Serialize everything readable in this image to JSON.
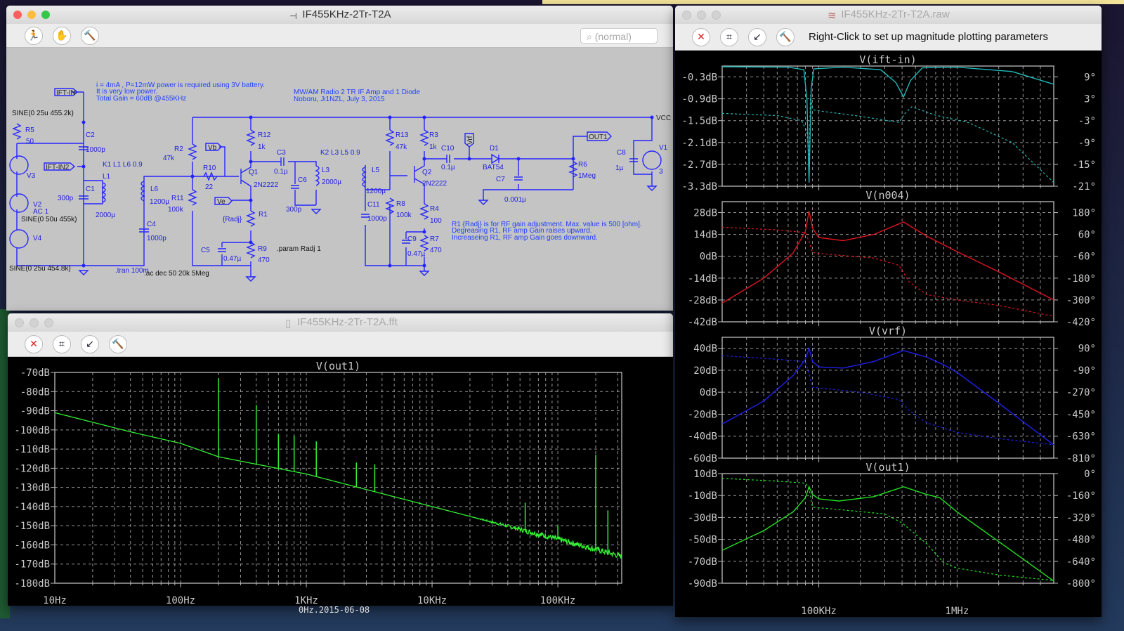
{
  "schematic_window": {
    "title": "IF455KHz-2Tr-T2A",
    "search_placeholder": "(normal)",
    "toolbar": [
      "run-icon",
      "halt-hand-icon",
      "control-panel-hammer-icon"
    ],
    "labels": {
      "note1": "i = 4mA , P=12mW power is required using 3V battery.",
      "note2": "It is very low power.",
      "note3": "Total Gain = 60dB @455KHz",
      "title1": "MW/AM Radio 2 TR IF Amp and 1 Diode",
      "title2": "Noboru, Ji1NZL, July 3, 2015",
      "ift_in": "IFT-IN",
      "ift_in2": "IFT-IN2",
      "sine_v3": "SINE(0 25u 455.2k)",
      "r5": "R5",
      "r5v": "50",
      "c2": "C2",
      "c2v": "1000p",
      "k1": "K1 L1 L6 0.9",
      "l1": "L1",
      "c1": "C1",
      "c1v": "300p",
      "l1v": "2000µ",
      "v3": "V3",
      "v2": "V2",
      "v2ac": "AC 1",
      "sine_v2": "SINE(0 50u 455k)",
      "v4": "V4",
      "sine_v4": "SINE(0 25u 454.8k)",
      "tran": ".tran 100m",
      "ac": ".ac dec 50 20k 5Meg",
      "l6": "L6",
      "l6v": "1200µ",
      "c4": "C4",
      "c4v": "1000p",
      "r2": "R2",
      "r2v": "47k",
      "r10": "R10",
      "r10v": "22",
      "r11": "R11",
      "r11v": "100k",
      "vb": "Vb",
      "ve": "Ve",
      "r12": "R12",
      "r12v": "1k",
      "q1": "Q1",
      "q1v": "2N2222",
      "c3": "C3",
      "c3v": "0.1µ",
      "c6": "C6",
      "c6v": "300p",
      "l3": "L3",
      "l3v": "2000µ",
      "k2": "K2 L3 L5 0.9",
      "r1": "R1",
      "r1v": "{Radj}",
      "c5": "C5",
      "c5v": "0.47µ",
      "r9": "R9",
      "r9v": "470",
      "param": ".param Radj 1",
      "r13": "R13",
      "r13v": "47k",
      "r3": "R3",
      "r3v": "1k",
      "c10": "C10",
      "c10v": "0.1µ",
      "vrf": "Vrf",
      "d1": "D1",
      "d1v": "BAT54",
      "c7": "C7",
      "c7v": "0.001µ",
      "out1": "OUT1",
      "r6": "R6",
      "r6v": "1Meg",
      "c8": "C8",
      "c8v": "1µ",
      "v1": "V1",
      "v1v": "3",
      "vcc": "VCC",
      "l5": "L5",
      "l5v": "1200µ",
      "c11": "C11",
      "c11v": "1000p",
      "r8": "R8",
      "r8v": "100k",
      "q2": "Q2",
      "q2v": "2N2222",
      "r4": "R4",
      "r4v": "100",
      "c9": "C9",
      "c9v": "0.47µ",
      "r7": "R7",
      "r7v": "470",
      "rnote1": "R1 {Radj} is for RF gain adjustment. Max. value is 500 [ohm].",
      "rnote2": "Degreasing R1, RF amp Gain raises upward.",
      "rnote3": "Increaseing R1, RF amp Gain goes downward."
    }
  },
  "raw_window": {
    "title": "IF455KHz-2Tr-T2A.raw",
    "toolbar": [
      "zoom-cancel-icon",
      "autorange-icon",
      "zoom-back-icon",
      "control-panel-hammer-icon"
    ],
    "hint": "Right-Click to set up magnitude plotting parameters"
  },
  "fft_window": {
    "title": "IF455KHz-2Tr-T2A.fft",
    "toolbar": [
      "zoom-cancel-icon",
      "autorange-icon",
      "zoom-back-icon",
      "control-panel-hammer-icon"
    ],
    "caption": "0Hz.2015-06-08"
  },
  "chart_data": [
    {
      "type": "line",
      "title": "V(ift-in)",
      "color": "#20b8b8",
      "xscale": "log",
      "xlim": [
        20000,
        5000000
      ],
      "x_ticklabels": [
        "100KHz",
        "1MHz"
      ],
      "x_ticks": [
        100000,
        1000000
      ],
      "ylim": [
        0,
        -3.3
      ],
      "yticks": [
        -0.3,
        -0.9,
        -1.5,
        -2.1,
        -2.7,
        -3.3
      ],
      "ytick_labels": [
        "-0.3dB",
        "-0.9dB",
        "-1.5dB",
        "-2.1dB",
        "-2.7dB",
        "-3.3dB"
      ],
      "y2lim": [
        12,
        -21
      ],
      "y2ticks": [
        9,
        3,
        -3,
        -9,
        -15,
        -21
      ],
      "y2tick_labels": [
        "9°",
        "3°",
        "-3°",
        "-9°",
        "-15°",
        "-21°"
      ],
      "magnitude": [
        [
          20000,
          -0.02
        ],
        [
          60000,
          -0.03
        ],
        [
          78000,
          -0.1
        ],
        [
          82000,
          -0.9
        ],
        [
          85000,
          -3.2
        ],
        [
          88000,
          -0.6
        ],
        [
          92000,
          -0.08
        ],
        [
          150000,
          -0.03
        ],
        [
          280000,
          -0.1
        ],
        [
          360000,
          -0.45
        ],
        [
          410000,
          -0.85
        ],
        [
          460000,
          -0.4
        ],
        [
          560000,
          -0.05
        ],
        [
          1000000,
          -0.03
        ],
        [
          2500000,
          -0.15
        ],
        [
          5000000,
          -0.5
        ]
      ],
      "phase": [
        [
          20000,
          -1
        ],
        [
          50000,
          -1.6
        ],
        [
          75000,
          -3
        ],
        [
          82000,
          -6
        ],
        [
          85000,
          -14
        ],
        [
          87000,
          4
        ],
        [
          90000,
          0
        ],
        [
          110000,
          -0.5
        ],
        [
          200000,
          -1.8
        ],
        [
          380000,
          -3.5
        ],
        [
          420000,
          -1
        ],
        [
          470000,
          0.8
        ],
        [
          700000,
          -1.5
        ],
        [
          1200000,
          -3.5
        ],
        [
          2500000,
          -9
        ],
        [
          5000000,
          -20
        ]
      ]
    },
    {
      "type": "line",
      "title": "V(n004)",
      "color": "#e01420",
      "xscale": "log",
      "xlim": [
        20000,
        5000000
      ],
      "ylim": [
        35,
        -42
      ],
      "yticks": [
        28,
        14,
        0,
        -14,
        -28,
        -42
      ],
      "ytick_labels": [
        "28dB",
        "14dB",
        "0dB",
        "-14dB",
        "-28dB",
        "-42dB"
      ],
      "y2lim": [
        240,
        -420
      ],
      "y2ticks": [
        180,
        60,
        -60,
        -180,
        -300,
        -420
      ],
      "y2tick_labels": [
        "180°",
        "60°",
        "-60°",
        "-180°",
        "-300°",
        "-420°"
      ],
      "magnitude": [
        [
          20000,
          -30
        ],
        [
          40000,
          -14
        ],
        [
          65000,
          2
        ],
        [
          80000,
          16
        ],
        [
          85000,
          29
        ],
        [
          90000,
          18
        ],
        [
          100000,
          12
        ],
        [
          150000,
          10
        ],
        [
          250000,
          14
        ],
        [
          410000,
          22
        ],
        [
          600000,
          13
        ],
        [
          1000000,
          3
        ],
        [
          2000000,
          -10
        ],
        [
          5000000,
          -28
        ]
      ],
      "phase": [
        [
          20000,
          100
        ],
        [
          50000,
          85
        ],
        [
          80000,
          70
        ],
        [
          85000,
          20
        ],
        [
          90000,
          -40
        ],
        [
          120000,
          -50
        ],
        [
          250000,
          -70
        ],
        [
          380000,
          -110
        ],
        [
          450000,
          -200
        ],
        [
          600000,
          -270
        ],
        [
          1000000,
          -300
        ],
        [
          2000000,
          -330
        ],
        [
          5000000,
          -390
        ]
      ]
    },
    {
      "type": "line",
      "title": "V(vrf)",
      "color": "#2020f0",
      "xscale": "log",
      "xlim": [
        20000,
        5000000
      ],
      "ylim": [
        50,
        -60
      ],
      "yticks": [
        40,
        20,
        0,
        -20,
        -40,
        -60
      ],
      "ytick_labels": [
        "40dB",
        "20dB",
        "0dB",
        "-20dB",
        "-40dB",
        "-60dB"
      ],
      "y2lim": [
        180,
        -810
      ],
      "y2ticks": [
        90,
        -90,
        -270,
        -450,
        -630,
        -810
      ],
      "y2tick_labels": [
        "90°",
        "-90°",
        "-270°",
        "-450°",
        "-630°",
        "-810°"
      ],
      "magnitude": [
        [
          20000,
          -29
        ],
        [
          40000,
          -8
        ],
        [
          65000,
          15
        ],
        [
          80000,
          30
        ],
        [
          85000,
          40
        ],
        [
          90000,
          28
        ],
        [
          100000,
          23
        ],
        [
          150000,
          22
        ],
        [
          250000,
          28
        ],
        [
          410000,
          38
        ],
        [
          600000,
          32
        ],
        [
          800000,
          25
        ],
        [
          1000000,
          18
        ],
        [
          2000000,
          -10
        ],
        [
          5000000,
          -48
        ]
      ],
      "phase": [
        [
          20000,
          30
        ],
        [
          50000,
          0
        ],
        [
          80000,
          -20
        ],
        [
          85000,
          -120
        ],
        [
          90000,
          -230
        ],
        [
          200000,
          -270
        ],
        [
          380000,
          -330
        ],
        [
          450000,
          -420
        ],
        [
          600000,
          -520
        ],
        [
          1000000,
          -600
        ],
        [
          2000000,
          -650
        ],
        [
          5000000,
          -700
        ]
      ]
    },
    {
      "type": "line",
      "title": "V(out1)",
      "color": "#20e020",
      "xscale": "log",
      "xlim": [
        20000,
        5000000
      ],
      "ylim": [
        10,
        -90
      ],
      "yticks": [
        10,
        -10,
        -30,
        -50,
        -70,
        -90
      ],
      "ytick_labels": [
        "10dB",
        "-10dB",
        "-30dB",
        "-50dB",
        "-70dB",
        "-90dB"
      ],
      "y2lim": [
        0,
        -800
      ],
      "y2ticks": [
        0,
        -160,
        -320,
        -480,
        -640,
        -800
      ],
      "y2tick_labels": [
        "0°",
        "-160°",
        "-320°",
        "-480°",
        "-640°",
        "-800°"
      ],
      "magnitude": [
        [
          20000,
          -60
        ],
        [
          40000,
          -42
        ],
        [
          65000,
          -25
        ],
        [
          80000,
          -12
        ],
        [
          85000,
          -2
        ],
        [
          90000,
          -9
        ],
        [
          100000,
          -13
        ],
        [
          140000,
          -15
        ],
        [
          250000,
          -11
        ],
        [
          410000,
          -2
        ],
        [
          600000,
          -9
        ],
        [
          750000,
          -12
        ],
        [
          1000000,
          -25
        ],
        [
          2000000,
          -52
        ],
        [
          5000000,
          -88
        ]
      ],
      "phase": [
        [
          20000,
          -35
        ],
        [
          50000,
          -55
        ],
        [
          80000,
          -70
        ],
        [
          85000,
          -110
        ],
        [
          90000,
          -245
        ],
        [
          150000,
          -265
        ],
        [
          300000,
          -295
        ],
        [
          400000,
          -360
        ],
        [
          600000,
          -510
        ],
        [
          800000,
          -650
        ],
        [
          1000000,
          -690
        ],
        [
          2000000,
          -740
        ],
        [
          5000000,
          -780
        ]
      ]
    },
    {
      "type": "line",
      "title": "V(out1)",
      "color": "#33f033",
      "xscale": "log",
      "xlim": [
        10,
        322000
      ],
      "x_ticks": [
        10,
        100,
        1000,
        10000,
        100000
      ],
      "x_ticklabels": [
        "10Hz",
        "100Hz",
        "1KHz",
        "10KHz",
        "100KHz"
      ],
      "ylim": [
        -70,
        -180
      ],
      "yticks": [
        -70,
        -80,
        -90,
        -100,
        -110,
        -120,
        -130,
        -140,
        -150,
        -160,
        -170,
        -180
      ],
      "ytick_labels": [
        "-70dB",
        "-80dB",
        "-90dB",
        "-100dB",
        "-110dB",
        "-120dB",
        "-130dB",
        "-140dB",
        "-150dB",
        "-160dB",
        "-170dB",
        "-180dB"
      ],
      "noise_floor": [
        [
          10,
          -91
        ],
        [
          20,
          -96
        ],
        [
          40,
          -101
        ],
        [
          100,
          -107
        ],
        [
          200,
          -114
        ],
        [
          1000,
          -123
        ],
        [
          10000,
          -140
        ],
        [
          100000,
          -157
        ],
        [
          322000,
          -166
        ]
      ],
      "spikes": [
        [
          200,
          -73
        ],
        [
          400,
          -87
        ],
        [
          600,
          -102
        ],
        [
          800,
          -103
        ],
        [
          1200,
          -106
        ],
        [
          2500,
          -117
        ],
        [
          3500,
          -118
        ],
        [
          55000,
          -138
        ],
        [
          100000,
          -150
        ],
        [
          200000,
          -113
        ],
        [
          250000,
          -142
        ]
      ]
    }
  ]
}
